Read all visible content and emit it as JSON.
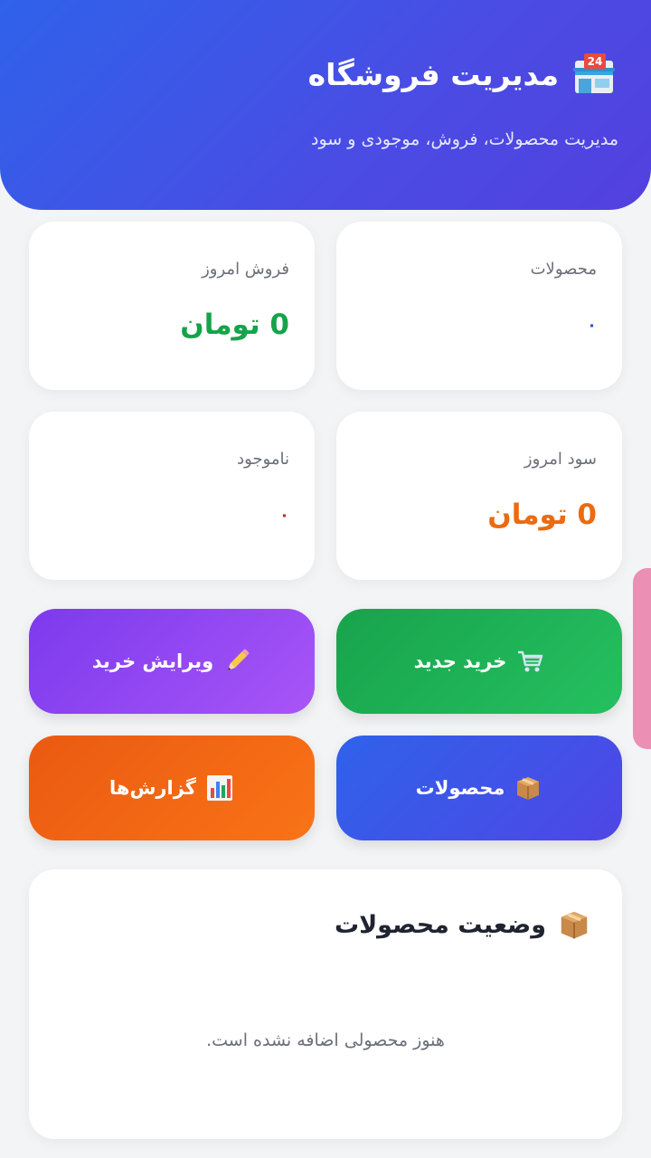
{
  "header": {
    "title": "مدیریت فروشگاه",
    "subtitle": "مدیریت محصولات، فروش، موجودی و سود",
    "icon": "store-24-icon"
  },
  "stats": {
    "products": {
      "label": "محصولات",
      "value": "۰",
      "color": "#2b54d8"
    },
    "sales_today": {
      "label": "فروش امروز",
      "value": "0 تومان",
      "color": "#16a34a"
    },
    "profit_today": {
      "label": "سود امروز",
      "value": "0 تومان",
      "color": "#ea6b12"
    },
    "out_of_stock": {
      "label": "ناموجود",
      "value": "۰",
      "color": "#dc2626"
    }
  },
  "actions": {
    "new_purchase": {
      "label": "خرید جدید",
      "icon": "shopping-cart-icon"
    },
    "edit_purchase": {
      "label": "ویرایش خرید",
      "icon": "pencil-icon"
    },
    "products": {
      "label": "محصولات",
      "icon": "package-icon"
    },
    "reports": {
      "label": "گزارش‌ها",
      "icon": "bar-chart-icon"
    }
  },
  "product_status": {
    "title": "وضعیت محصولات",
    "icon": "package-icon",
    "empty_message": "هنوز محصولی اضافه نشده است."
  },
  "colors": {
    "header_gradient_start": "#2f62ea",
    "header_gradient_end": "#5340de",
    "green_button": "#22b35a",
    "purple_button": "#9b4cf2",
    "blue_button": "#3c5ee8",
    "orange_button": "#f0711a",
    "side_tab": "#ec8fb4"
  }
}
